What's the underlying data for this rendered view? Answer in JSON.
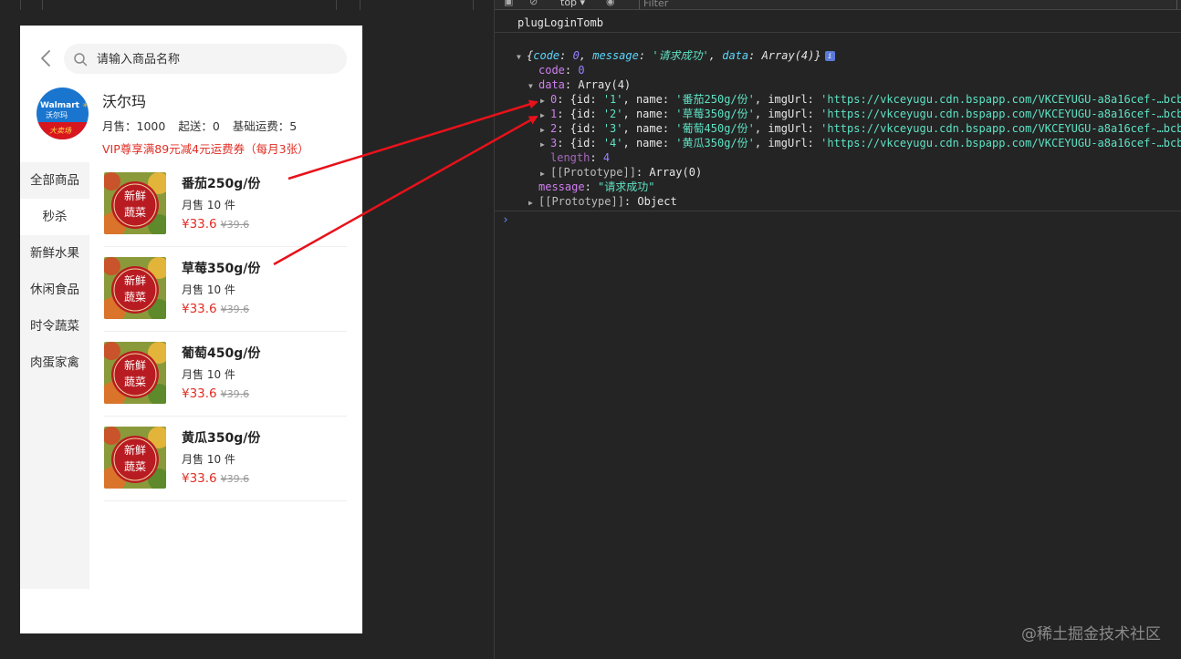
{
  "app": {
    "search_placeholder": "请输入商品名称",
    "shop": {
      "name": "沃尔玛",
      "logo_text_en": "Walmart",
      "logo_text_cn": "沃尔玛",
      "logo_banner": "大卖场",
      "monthly_sales": "月售：1000",
      "min_order": "起送：0",
      "base_fee": "基础运费：5",
      "vip_promo": "VIP尊享满89元减4元运费券（每月3张）"
    },
    "categories": [
      "全部商品",
      "秒杀",
      "新鲜水果",
      "休闲食品",
      "时令蔬菜",
      "肉蛋家禽"
    ],
    "active_category_index": 1,
    "thumb_badge": [
      "新鲜",
      "蔬菜"
    ],
    "products": [
      {
        "name": "番茄250g/份",
        "sold": "月售 10 件",
        "price": "¥33.6",
        "original_price": "¥39.6"
      },
      {
        "name": "草莓350g/份",
        "sold": "月售 10 件",
        "price": "¥33.6",
        "original_price": "¥39.6"
      },
      {
        "name": "葡萄450g/份",
        "sold": "月售 10 件",
        "price": "¥33.6",
        "original_price": "¥39.6"
      },
      {
        "name": "黄瓜350g/份",
        "sold": "月售 10 件",
        "price": "¥33.6",
        "original_price": "¥39.6"
      }
    ]
  },
  "devtools": {
    "context": "top ▾",
    "filter_placeholder": "Filter",
    "log_label": "plugLoginTomb",
    "summary": {
      "open": "{",
      "code_key": "code",
      "code_val": "0",
      "message_key": "message",
      "message_val": "'请求成功'",
      "data_key": "data",
      "data_val": "Array(4)",
      "close": "}"
    },
    "code_line": {
      "key": "code",
      "val": "0"
    },
    "data_line": {
      "key": "data",
      "val": "Array(4)"
    },
    "array_items": [
      {
        "idx": "0",
        "id": "'1'",
        "name": "'番茄250g/份'",
        "img": "'https://vkceyugu.cdn.bspapp.com/VKCEYUGU-a8a16cef-…bcb"
      },
      {
        "idx": "1",
        "id": "'2'",
        "name": "'草莓350g/份'",
        "img": "'https://vkceyugu.cdn.bspapp.com/VKCEYUGU-a8a16cef-…bcb"
      },
      {
        "idx": "2",
        "id": "'3'",
        "name": "'葡萄450g/份'",
        "img": "'https://vkceyugu.cdn.bspapp.com/VKCEYUGU-a8a16cef-…bcb"
      },
      {
        "idx": "3",
        "id": "'4'",
        "name": "'黄瓜350g/份'",
        "img": "'https://vkceyugu.cdn.bspapp.com/VKCEYUGU-a8a16cef-…bcb"
      }
    ],
    "length_line": {
      "key": "length",
      "val": "4"
    },
    "array_proto": {
      "key": "[[Prototype]]",
      "val": "Array(0)"
    },
    "message_line": {
      "key": "message",
      "val": "\"请求成功\""
    },
    "object_proto": {
      "key": "[[Prototype]]",
      "val": "Object"
    },
    "prompt": "›"
  },
  "watermark": "@稀土掘金技术社区",
  "colors": {
    "price_red": "#e02e24",
    "arrow_red": "#e8121a",
    "sidebar_bg": "#f4f4f4",
    "console_bg": "#242424"
  }
}
